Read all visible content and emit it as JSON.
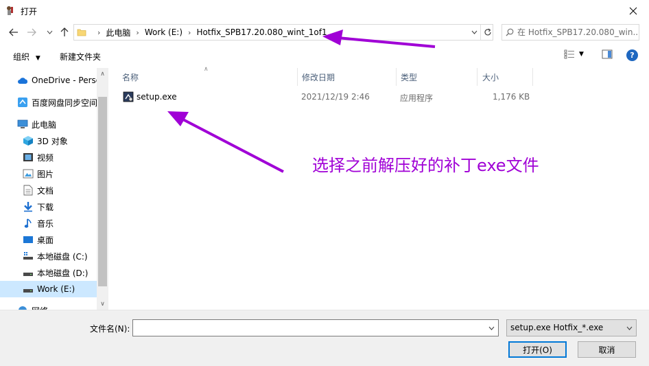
{
  "window": {
    "title": "打开"
  },
  "nav": {
    "breadcrumbs": [
      "此电脑",
      "Work (E:)",
      "Hotfix_SPB17.20.080_wint_1of1"
    ],
    "search_placeholder": "在 Hotfix_SPB17.20.080_win..."
  },
  "toolbar": {
    "organize": "组织",
    "new_folder": "新建文件夹"
  },
  "sidebar": {
    "items": [
      {
        "label": "OneDrive - Personal",
        "icon": "cloud-icon"
      },
      {
        "label": "百度网盘同步空间",
        "icon": "baidu-sync-icon"
      },
      {
        "label": "此电脑",
        "icon": "computer-icon"
      },
      {
        "label": "3D 对象",
        "icon": "cube-icon"
      },
      {
        "label": "视频",
        "icon": "video-icon"
      },
      {
        "label": "图片",
        "icon": "picture-icon"
      },
      {
        "label": "文档",
        "icon": "document-icon"
      },
      {
        "label": "下载",
        "icon": "download-icon"
      },
      {
        "label": "音乐",
        "icon": "music-icon"
      },
      {
        "label": "桌面",
        "icon": "desktop-icon"
      },
      {
        "label": "本地磁盘 (C:)",
        "icon": "drive-icon"
      },
      {
        "label": "本地磁盘 (D:)",
        "icon": "drive-icon"
      },
      {
        "label": "Work (E:)",
        "icon": "drive-icon"
      },
      {
        "label": "网络",
        "icon": "network-icon"
      }
    ],
    "selected": "Work (E:)"
  },
  "files": {
    "columns": [
      "名称",
      "修改日期",
      "类型",
      "大小"
    ],
    "rows": [
      {
        "name": "setup.exe",
        "date": "2021/12/19 2:46",
        "type": "应用程序",
        "size": "1,176 KB"
      }
    ]
  },
  "bottom": {
    "filename_label": "文件名(N):",
    "filename_value": "",
    "filter": "setup.exe Hotfix_*.exe",
    "open": "打开(O)",
    "cancel": "取消"
  },
  "annotation": {
    "text": "选择之前解压好的补丁exe文件",
    "color": "#a000d6"
  }
}
